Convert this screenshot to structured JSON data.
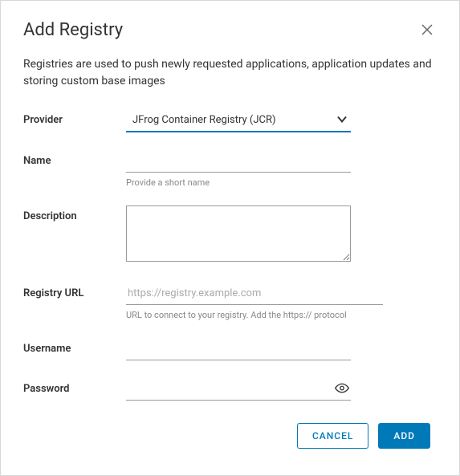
{
  "dialog": {
    "title": "Add Registry",
    "description": "Registries are used to push newly requested applications, application updates and storing custom base images"
  },
  "form": {
    "provider": {
      "label": "Provider",
      "value": "JFrog Container Registry (JCR)"
    },
    "name": {
      "label": "Name",
      "value": "",
      "helper": "Provide a short name"
    },
    "descriptionField": {
      "label": "Description",
      "value": ""
    },
    "registryUrl": {
      "label": "Registry URL",
      "value": "",
      "placeholder": "https://registry.example.com",
      "helper": "URL to connect to your registry. Add the https:// protocol"
    },
    "username": {
      "label": "Username",
      "value": ""
    },
    "password": {
      "label": "Password",
      "value": ""
    }
  },
  "buttons": {
    "cancel": "CANCEL",
    "add": "ADD"
  }
}
